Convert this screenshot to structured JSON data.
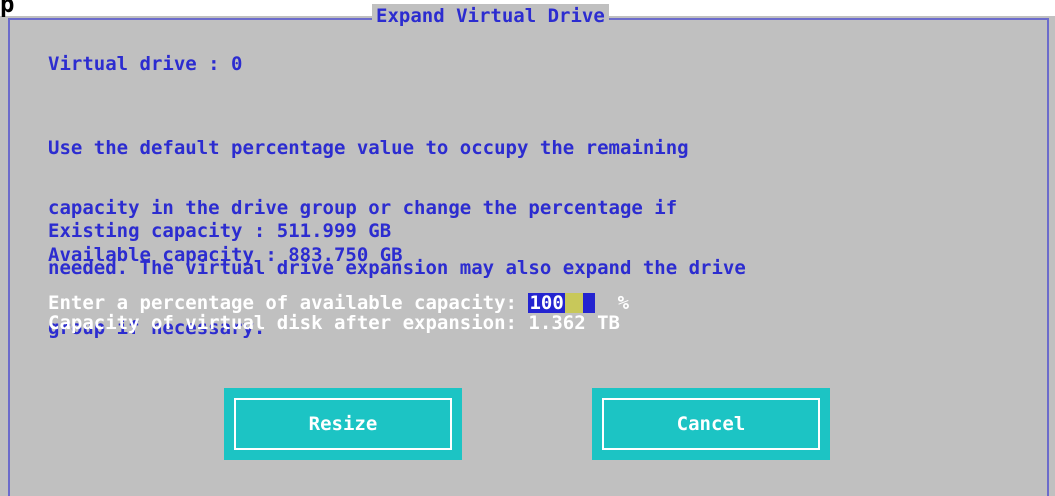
{
  "top_strip": {
    "label": "p"
  },
  "dialog": {
    "title": "Expand Virtual Drive",
    "virtual_drive_line": "Virtual drive : 0",
    "description_lines": [
      "Use the default percentage value to occupy the remaining",
      "capacity in the drive group or change the percentage if",
      "needed. The virtual drive expansion may also expand the drive",
      "group if necessary."
    ],
    "existing_capacity": "Existing capacity : 511.999 GB",
    "available_capacity": "Available capacity : 883.750 GB",
    "percentage_prompt": "Enter a percentage of available capacity: ",
    "percentage_value": "100",
    "percentage_unit": "%",
    "capacity_after": "Capacity of virtual disk after expansion: 1.362 TB"
  },
  "buttons": {
    "resize_label": "Resize",
    "cancel_label": "Cancel"
  },
  "colors": {
    "background": "#c0c0c0",
    "text_blue": "#2c2cd0",
    "text_white": "#ffffff",
    "button_cyan": "#1cc4c4",
    "frame_border": "#6b6bcb",
    "input_highlight": "#2424d0",
    "cursor_yellow": "#c8c85a"
  }
}
